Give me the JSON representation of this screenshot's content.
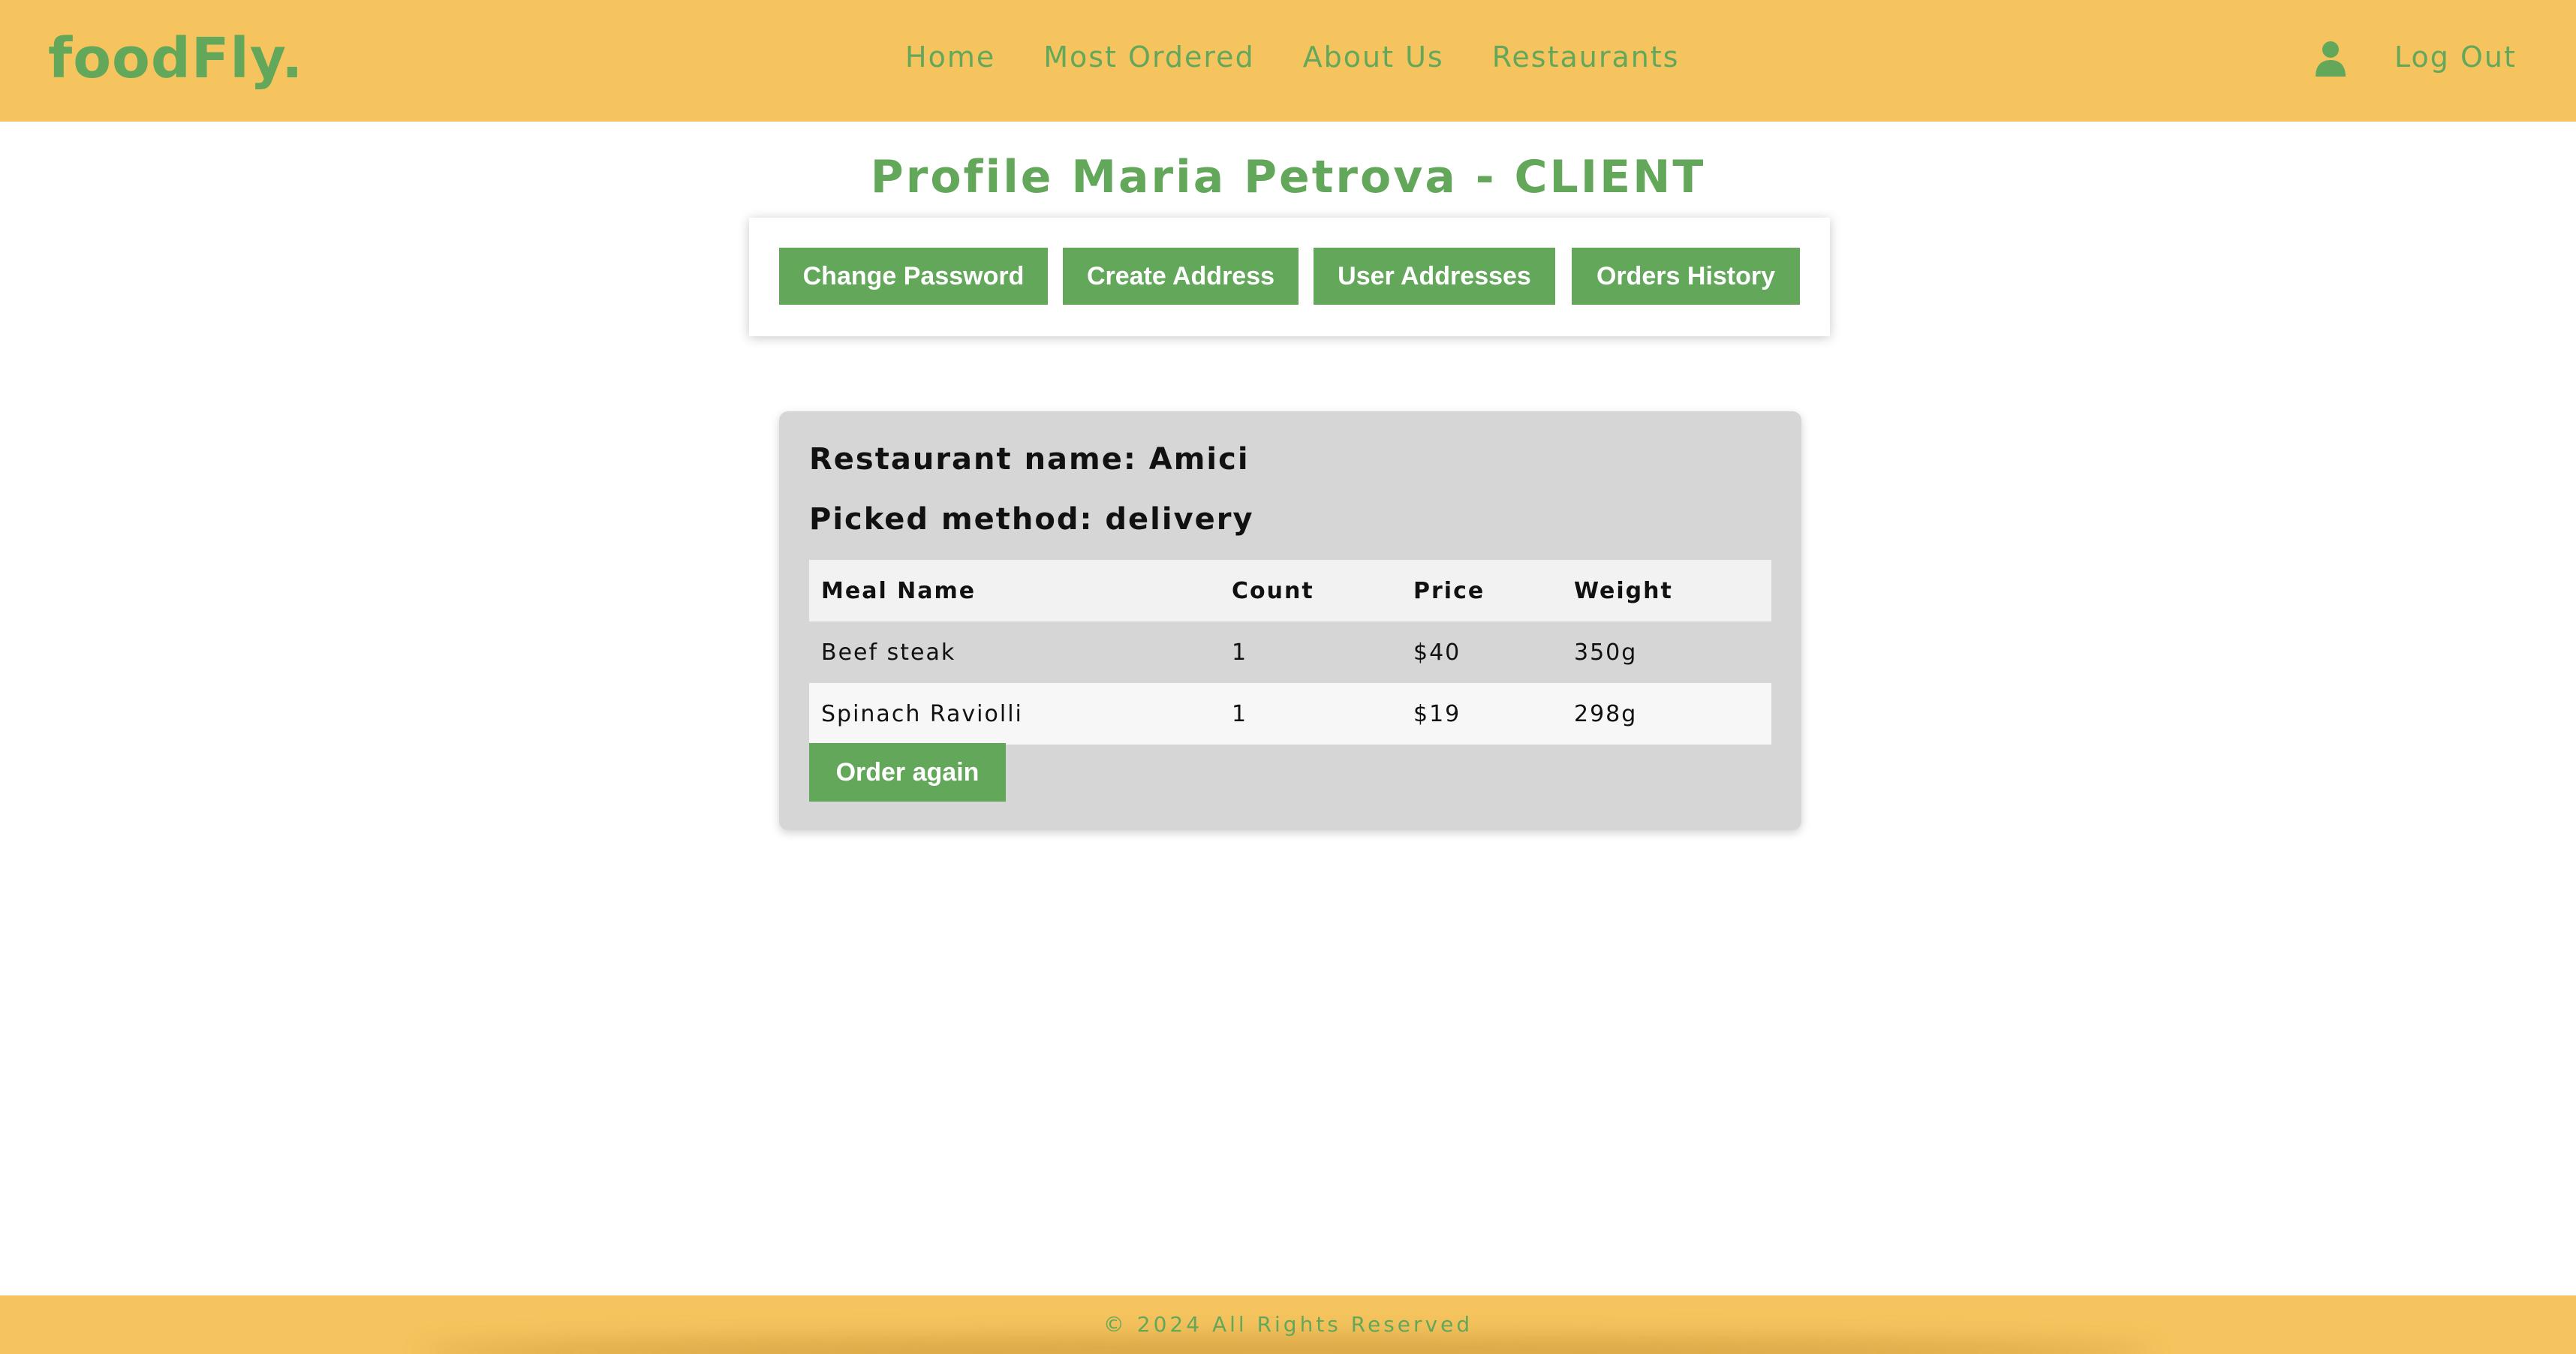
{
  "header": {
    "logo": "foodFly.",
    "nav": [
      "Home",
      "Most Ordered",
      "About Us",
      "Restaurants"
    ],
    "user_icon": "user-icon",
    "logout_label": "Log Out"
  },
  "profile": {
    "title": "Profile Maria Petrova - CLIENT",
    "buttons": {
      "change_password": "Change Password",
      "create_address": "Create Address",
      "user_addresses": "User Addresses",
      "orders_history": "Orders History"
    }
  },
  "order": {
    "restaurant_line": "Restaurant name: Amici",
    "method_line": "Picked method: delivery",
    "columns": [
      "Meal Name",
      "Count",
      "Price",
      "Weight"
    ],
    "rows": [
      [
        "Beef steak",
        "1",
        "$40",
        "350g"
      ],
      [
        "Spinach Raviolli",
        "1",
        "$19",
        "298g"
      ]
    ],
    "order_again_label": "Order again"
  },
  "footer": {
    "text": "© 2024 All Rights Reserved"
  },
  "colors": {
    "header_bg": "#f5c45e",
    "brand_green": "#63a85a",
    "card_bg": "#d6d6d6"
  }
}
